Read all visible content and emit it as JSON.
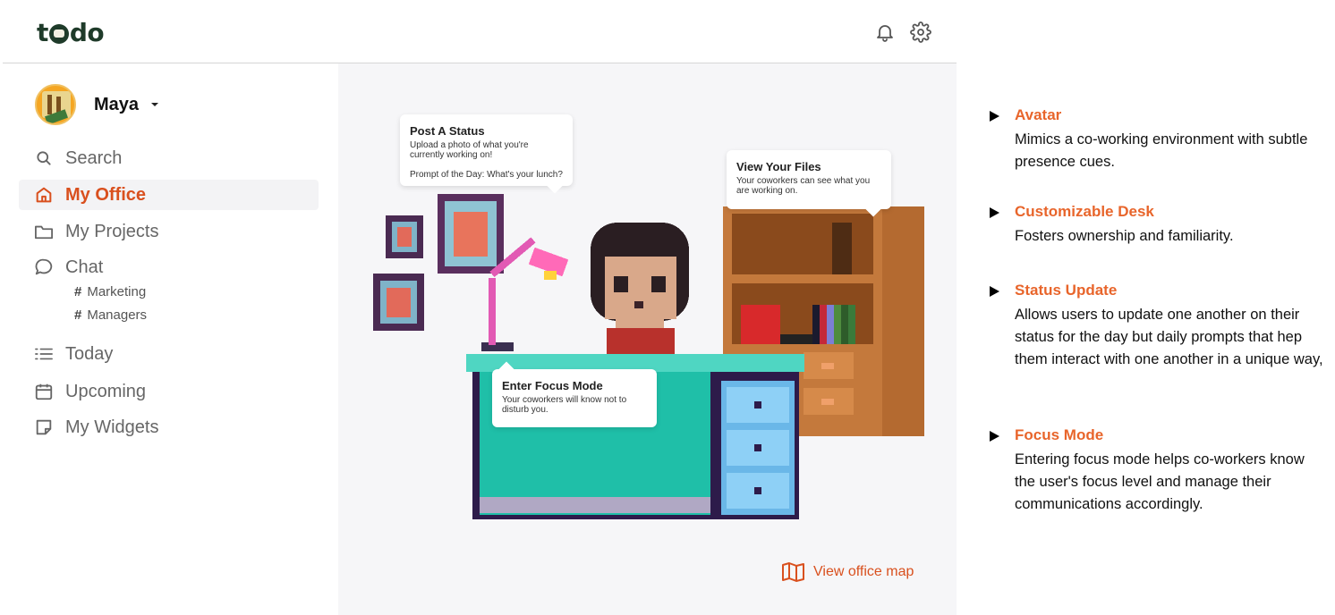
{
  "app": {
    "logo": "todo",
    "notifications_icon": "bell-icon",
    "settings_icon": "gear-icon"
  },
  "user": {
    "name": "Maya"
  },
  "sidebar": {
    "items": [
      {
        "label": "Search",
        "icon": "search-icon"
      },
      {
        "label": "My Office",
        "icon": "home-icon",
        "active": true
      },
      {
        "label": "My Projects",
        "icon": "folder-icon"
      },
      {
        "label": "Chat",
        "icon": "chat-bubble-icon"
      },
      {
        "label": "Today",
        "icon": "list-icon"
      },
      {
        "label": "Upcoming",
        "icon": "calendar-icon"
      },
      {
        "label": "My Widgets",
        "icon": "sticker-icon"
      }
    ],
    "channels": [
      {
        "label": "Marketing"
      },
      {
        "label": "Managers"
      }
    ],
    "channel_prefix": "#"
  },
  "office": {
    "status_bubble": {
      "title": "Post A Status",
      "body": "Upload a photo of what you're currently working on!",
      "prompt": "Prompt of the Day: What's your lunch?"
    },
    "files_bubble": {
      "title": "View Your Files",
      "body": "Your coworkers can see what you are working on."
    },
    "focus_bubble": {
      "title": "Enter Focus Mode",
      "body": "Your coworkers will know not to disturb you."
    },
    "view_map_label": "View office map",
    "view_map_icon": "map-icon"
  },
  "annotations": [
    {
      "title": "Avatar",
      "body": "Mimics a co-working environment with subtle presence cues."
    },
    {
      "title": "Customizable Desk",
      "body": "Fosters ownership and familiarity."
    },
    {
      "title": "Status Update",
      "body": "Allows users to update one another on their status for the day but daily prompts that hep them interact with one another in a unique way,"
    },
    {
      "title": "Focus Mode",
      "body": "Entering focus mode helps co-workers know the user's focus level and manage their communications accordingly."
    }
  ],
  "colors": {
    "accent": "#d9501e",
    "annotation_title": "#e8652b",
    "logo": "#1f3b2a",
    "desk_teal": "#1fbfa8",
    "shelf_brown": "#c4793c"
  }
}
